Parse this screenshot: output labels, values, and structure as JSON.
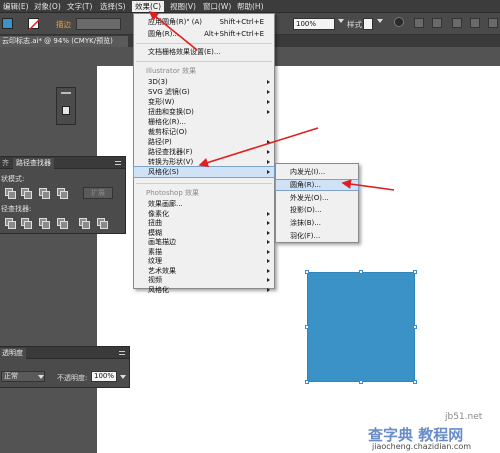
{
  "menubar": {
    "items": [
      "编辑(E)",
      "对象(O)",
      "文字(T)",
      "选择(S)",
      "效果(C)",
      "视图(V)",
      "窗口(W)",
      "帮助(H)"
    ]
  },
  "controlbar": {
    "stroke_label": "描边",
    "opacity_value": "100%",
    "style_label": "样式"
  },
  "doc_tab": "云印标志.ai* @ 94% (CMYK/预览)",
  "pathfinder_panel": {
    "tab1": "齐",
    "tab2": "路径查找器",
    "shape_modes": "状模式:",
    "pathfinders": "径查找器:",
    "expand": "扩展"
  },
  "transparency_panel": {
    "title": "透明度",
    "blend_mode": "正常",
    "opacity_label": "不透明度:",
    "opacity_value": "100%"
  },
  "effect_menu": {
    "apply_label": "应用",
    "apply_suffix": "圆角(R)\" (A)",
    "apply_shortcut": "Shift+Ctrl+E",
    "last_label": "圆角(R)...",
    "last_shortcut": "Alt+Shift+Ctrl+E",
    "doc_raster": "文档栅格效果设置(E)...",
    "illustrator_header": "Illustrator 效果",
    "illustrator_items": [
      "3D(3)",
      "SVG 滤镜(G)",
      "变形(W)",
      "扭曲和变换(D)",
      "栅格化(R)...",
      "裁剪标记(O)",
      "路径(P)",
      "路径查找器(F)",
      "转换为形状(V)",
      "风格化(S)"
    ],
    "photoshop_header": "Photoshop 效果",
    "photoshop_items": [
      "效果画廊...",
      "像素化",
      "扭曲",
      "模糊",
      "画笔描边",
      "素描",
      "纹理",
      "艺术效果",
      "视频",
      "风格化"
    ]
  },
  "stylize_submenu": {
    "items": [
      "内发光(I)...",
      "圆角(R)...",
      "外发光(O)...",
      "投影(D)...",
      "涂抹(B)...",
      "羽化(F)..."
    ]
  },
  "watermark": {
    "site": "查字典 教程网",
    "url": "jiaocheng.chazidian.com",
    "domain": "jb51.net"
  },
  "colors": {
    "shape_fill": "#3a92c6",
    "arrow": "#e02020",
    "menu_highlight": "#cfe2f6"
  }
}
